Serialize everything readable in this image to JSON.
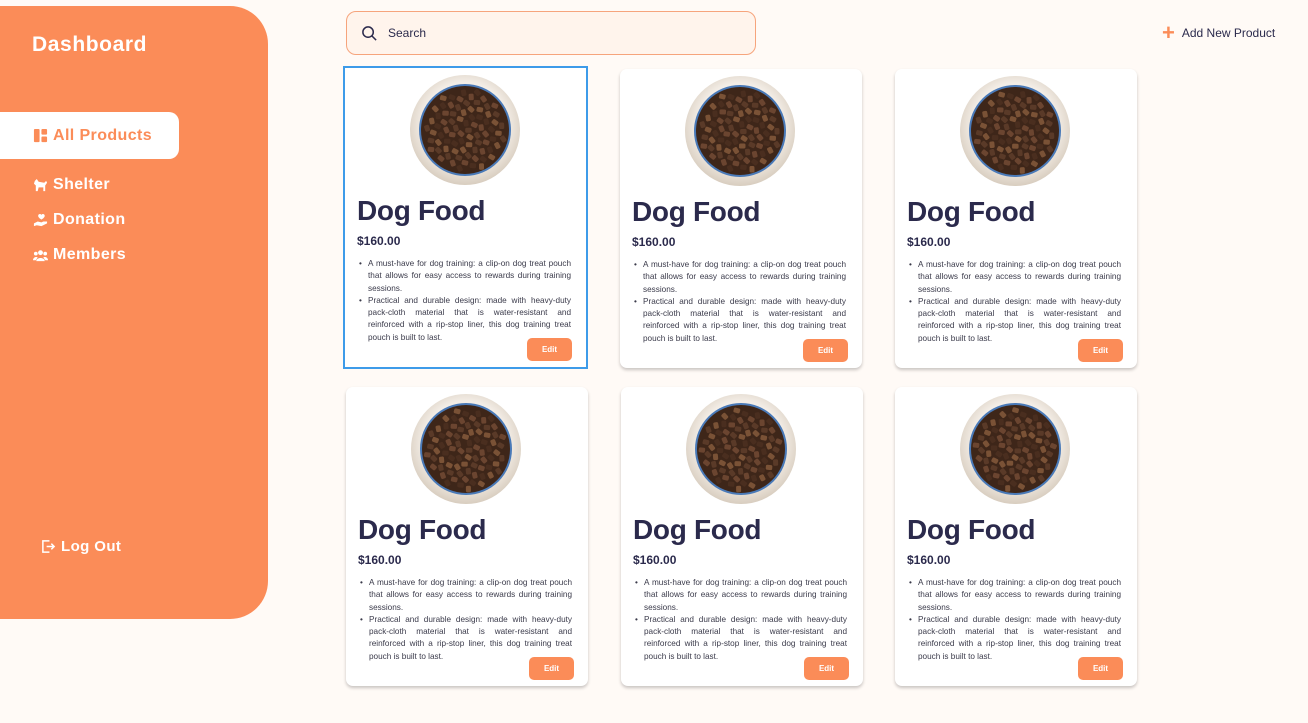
{
  "sidebar": {
    "title": "Dashboard",
    "items": [
      {
        "label": "All Products",
        "icon": "dashboard-icon"
      },
      {
        "label": "Shelter",
        "icon": "dog-icon"
      },
      {
        "label": "Donation",
        "icon": "hand-heart-icon"
      },
      {
        "label": "Members",
        "icon": "users-icon"
      }
    ],
    "logout": "Log Out"
  },
  "search": {
    "placeholder": "Search"
  },
  "header": {
    "add_label": "Add New Product"
  },
  "products": [
    {
      "title": "Dog Food",
      "price": "$160.00",
      "bullets": [
        "A must-have for dog training: a clip-on dog treat pouch that allows for easy access to rewards during training sessions.",
        "Practical and durable design: made with heavy-duty pack-cloth material that is water-resistant and reinforced with a rip-stop liner, this dog training treat pouch is built to last."
      ],
      "edit": "Edit"
    },
    {
      "title": "Dog Food",
      "price": "$160.00",
      "bullets": [
        "A must-have for dog training: a clip-on dog treat pouch that allows for easy access to rewards during training sessions.",
        "Practical and durable design: made with heavy-duty pack-cloth material that is water-resistant and reinforced with a rip-stop liner, this dog training treat pouch is built to last."
      ],
      "edit": "Edit"
    },
    {
      "title": "Dog Food",
      "price": "$160.00",
      "bullets": [
        "A must-have for dog training: a clip-on dog treat pouch that allows for easy access to rewards during training sessions.",
        "Practical and durable design: made with heavy-duty pack-cloth material that is water-resistant and reinforced with a rip-stop liner, this dog training treat pouch is built to last."
      ],
      "edit": "Edit"
    },
    {
      "title": "Dog Food",
      "price": "$160.00",
      "bullets": [
        "A must-have for dog training: a clip-on dog treat pouch that allows for easy access to rewards during training sessions.",
        "Practical and durable design: made with heavy-duty pack-cloth material that is water-resistant and reinforced with a rip-stop liner, this dog training treat pouch is built to last."
      ],
      "edit": "Edit"
    },
    {
      "title": "Dog Food",
      "price": "$160.00",
      "bullets": [
        "A must-have for dog training: a clip-on dog treat pouch that allows for easy access to rewards during training sessions.",
        "Practical and durable design: made with heavy-duty pack-cloth material that is water-resistant and reinforced with a rip-stop liner, this dog training treat pouch is built to last."
      ],
      "edit": "Edit"
    },
    {
      "title": "Dog Food",
      "price": "$160.00",
      "bullets": [
        "A must-have for dog training: a clip-on dog treat pouch that allows for easy access to rewards during training sessions.",
        "Practical and durable design: made with heavy-duty pack-cloth material that is water-resistant and reinforced with a rip-stop liner, this dog training treat pouch is built to last."
      ],
      "edit": "Edit"
    }
  ],
  "colors": {
    "accent": "#fb8c58",
    "text": "#2b2a4c",
    "selected_border": "#3d9be9",
    "background": "#fffaf6"
  }
}
